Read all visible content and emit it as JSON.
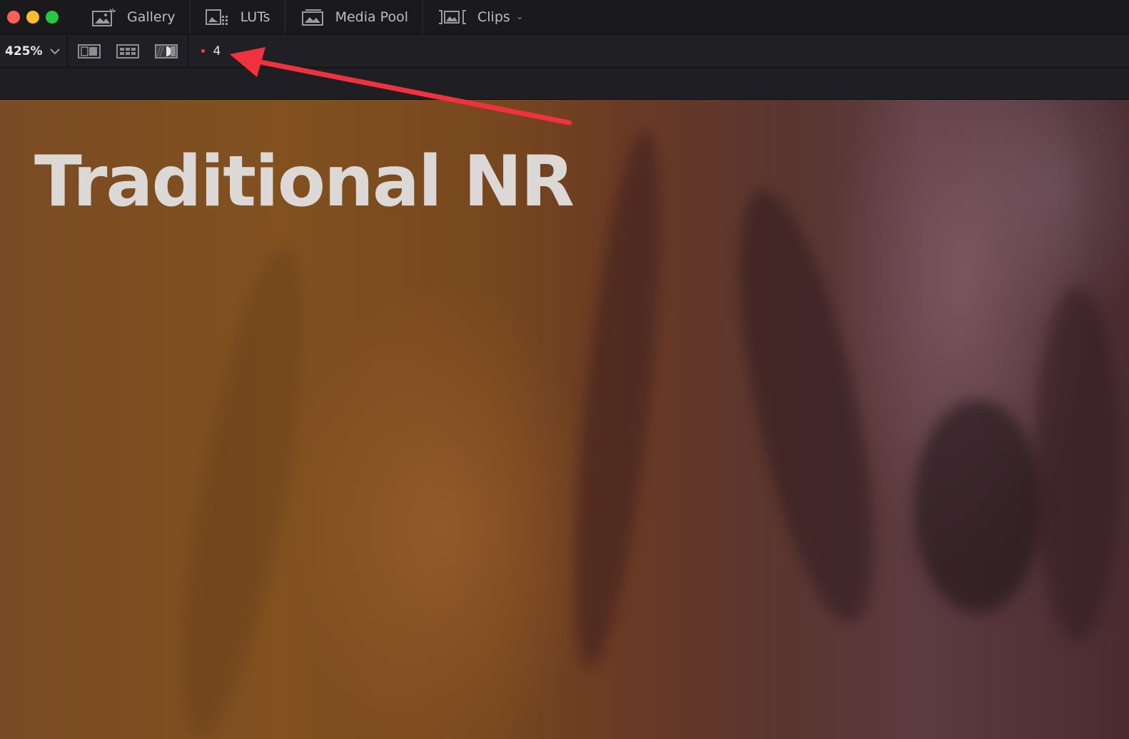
{
  "window": {
    "traffic_lights": [
      "close",
      "minimize",
      "maximize"
    ]
  },
  "tabs": [
    {
      "label": "Gallery",
      "icon": "gallery-icon"
    },
    {
      "label": "LUTs",
      "icon": "luts-icon"
    },
    {
      "label": "Media Pool",
      "icon": "media-pool-icon"
    },
    {
      "label": "Clips",
      "icon": "clips-icon",
      "dropdown": true
    }
  ],
  "toolbar": {
    "zoom": "425%",
    "view_modes": [
      "single-view-icon",
      "grid-view-icon",
      "split-view-icon"
    ],
    "count": "4"
  },
  "viewer": {
    "overlay_title": "Traditional NR"
  },
  "annotation": {
    "arrow_color": "#f0323f"
  },
  "colors": {
    "close": "#fe5f57",
    "minimize": "#febc2e",
    "maximize": "#28c840",
    "indicator_dot": "#ff3b3b"
  }
}
